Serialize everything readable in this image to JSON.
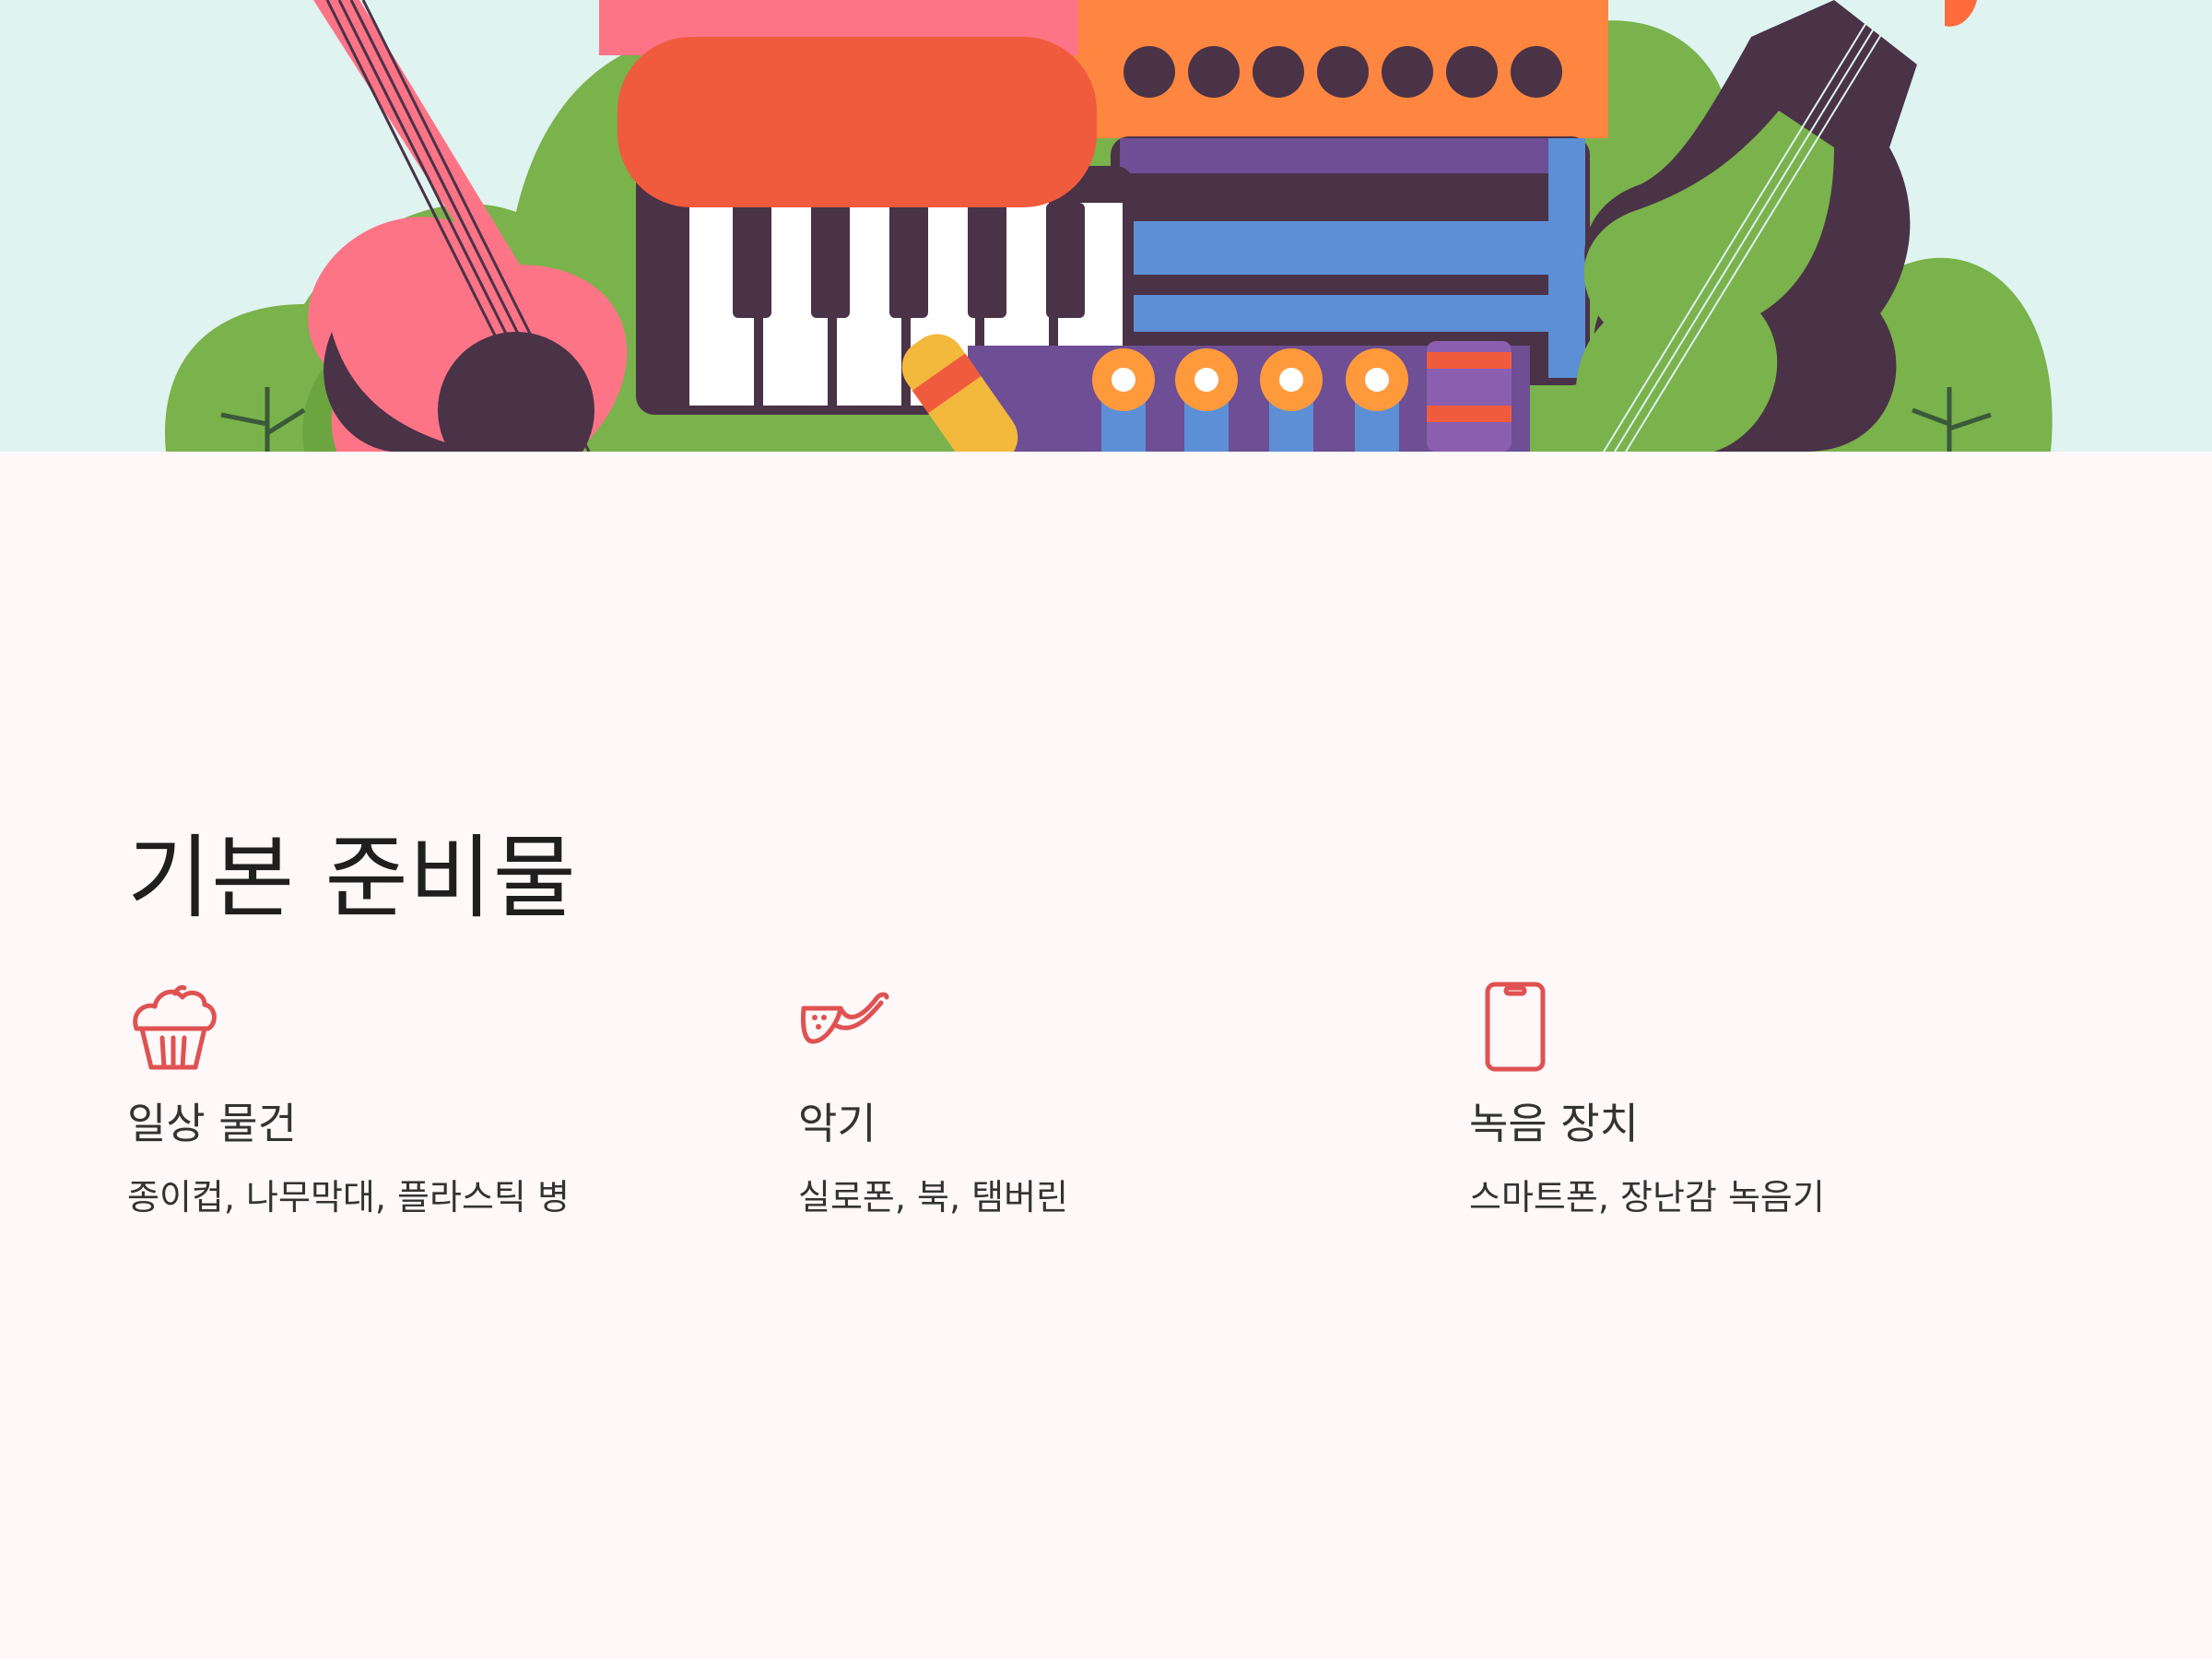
{
  "section": {
    "title": "기본 준비물"
  },
  "items": [
    {
      "icon": "cupcake-icon",
      "title": "일상 물건",
      "description": "종이컵, 나무막대, 플라스틱 병"
    },
    {
      "icon": "saxophone-icon",
      "title": "악기",
      "description": "실로폰, 북, 탬버린"
    },
    {
      "icon": "smartphone-icon",
      "title": "녹음 장치",
      "description": "스마트폰, 장난감 녹음기"
    }
  ],
  "colors": {
    "background": "#fef8f8",
    "accent": "#e05252",
    "text": "#1f1f1f"
  }
}
